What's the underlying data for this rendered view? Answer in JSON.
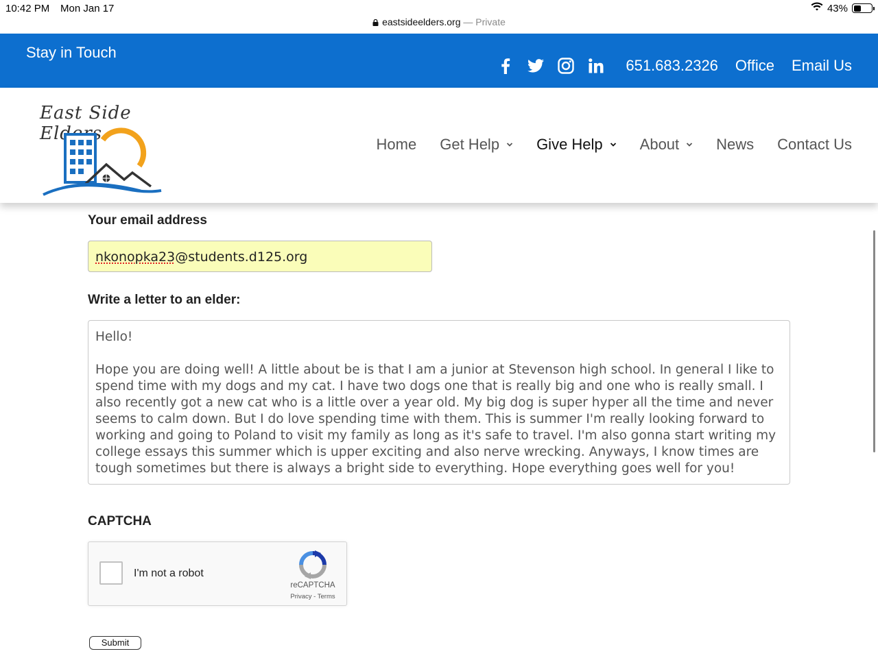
{
  "status_bar": {
    "time": "10:42 PM",
    "date": "Mon Jan 17",
    "battery": "43%",
    "battery_level": 0.43
  },
  "url_bar": {
    "domain": "eastsideelders.org",
    "mode": " — Private"
  },
  "top_bar": {
    "title": "Stay in Touch",
    "social_icons": [
      "facebook-icon",
      "twitter-icon",
      "instagram-icon",
      "linkedin-icon"
    ],
    "phone": "651.683.2326",
    "office": "Office",
    "email": "Email Us",
    "bg_color": "#0d6fcf"
  },
  "logo": {
    "text": "East Side Elders"
  },
  "nav": {
    "home": "Home",
    "get_help": "Get Help",
    "give_help": "Give Help",
    "about": "About",
    "news": "News",
    "contact": "Contact Us"
  },
  "form": {
    "email_label": "Your email address",
    "email_user": "nkonopka23",
    "email_domain": "@students.d125.org",
    "letter_label": "Write a letter to an elder:",
    "letter_text": "Hello!\n\nHope you are doing well! A little about be is that I am a junior at Stevenson high school. In general I like to spend time with my dogs and my cat. I have two dogs one that is really big and one who is really small. I also recently got a new cat who is a little over a year old. My big dog is super hyper all the time and never seems to calm down. But I do love spending time with them. This is summer I'm really looking forward to working and going to Poland to visit my family as long as it's safe to travel. I'm also gonna start writing my college essays this summer which is upper exciting and also nerve wrecking. Anyways, I know times are tough sometimes but there is always a bright side to everything. Hope everything goes well for you!",
    "captcha_label": "CAPTCHA",
    "captcha_checkbox_text": "I'm not a robot",
    "captcha_brand": "reCAPTCHA",
    "captcha_links": "Privacy - Terms",
    "submit": "Submit"
  }
}
